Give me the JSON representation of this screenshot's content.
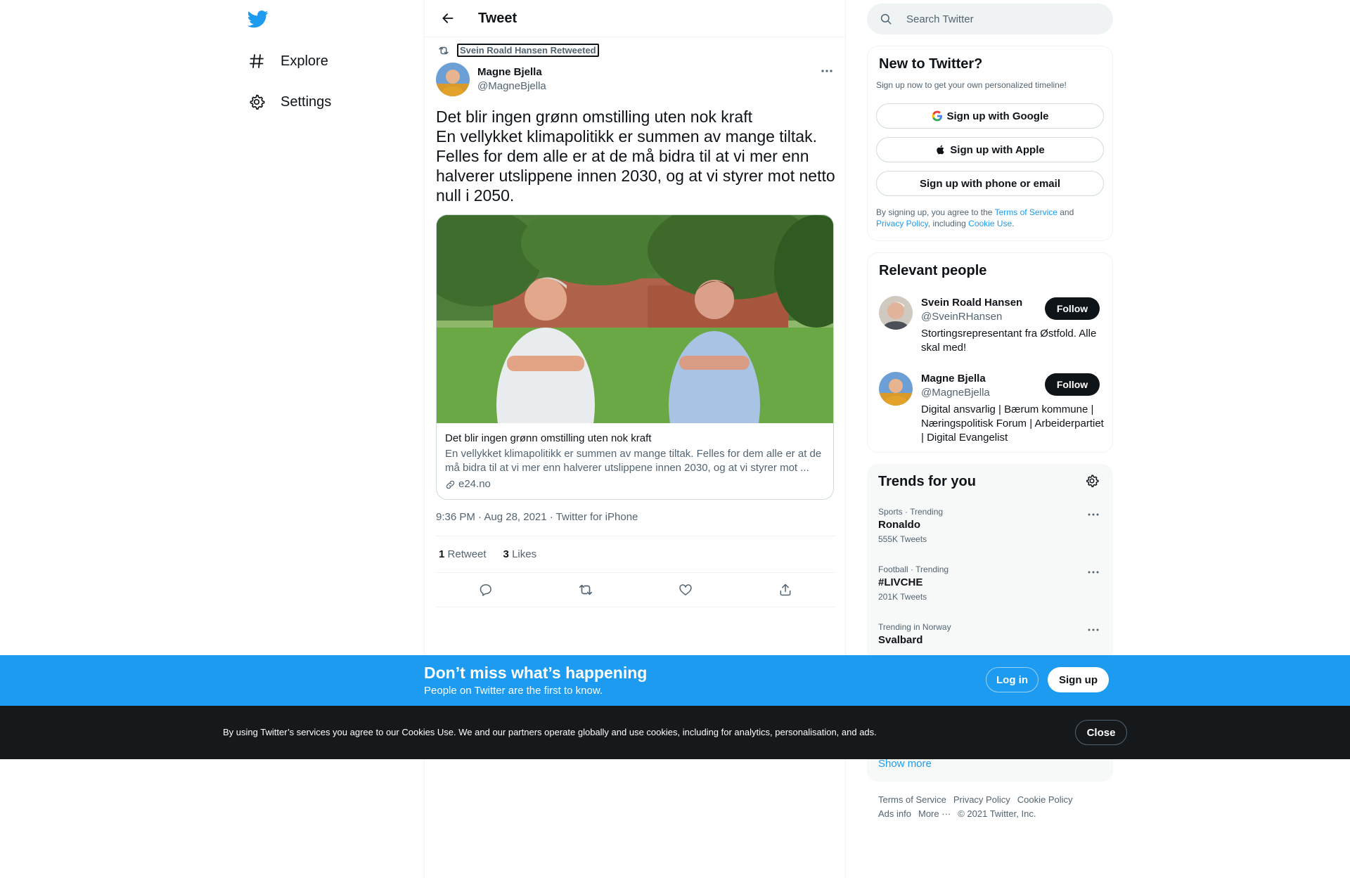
{
  "nav": {
    "logo": "twitter-bird-icon",
    "items": [
      {
        "label": "Explore",
        "icon": "hashtag-icon"
      },
      {
        "label": "Settings",
        "icon": "gear-icon"
      }
    ]
  },
  "header": {
    "title": "Tweet",
    "back_icon": "arrow-left-icon"
  },
  "tweet": {
    "retweeted_by": "Svein Roald Hansen Retweeted",
    "author_name": "Magne Bjella",
    "author_handle": "@MagneBjella",
    "text": "Det blir ingen grønn omstilling uten nok kraft\nEn vellykket klimapolitikk er summen av mange tiltak. Felles for dem alle er at de må bidra til at vi mer enn halverer utslippene innen 2030, og at vi styrer mot netto null i 2050.",
    "card": {
      "title": "Det blir ingen grønn omstilling uten nok kraft",
      "description": "En vellykket klimapolitikk er summen av mange tiltak. Felles for dem alle er at de må bidra til at vi mer enn halverer utslippene innen 2030, og at vi styrer mot ...",
      "domain": "e24.no"
    },
    "timestamp": "9:36 PM · Aug 28, 2021 · Twitter for iPhone",
    "retweets_count": "1",
    "retweets_label": "Retweet",
    "likes_count": "3",
    "likes_label": "Likes"
  },
  "search": {
    "placeholder": "Search Twitter"
  },
  "signup_panel": {
    "title": "New to Twitter?",
    "subtitle": "Sign up now to get your own personalized timeline!",
    "google": "Sign up with Google",
    "apple": "Sign up with Apple",
    "phone": "Sign up with phone or email",
    "legal_1": "By signing up, you agree to the ",
    "terms": "Terms of Service",
    "legal_2": " and ",
    "privacy": "Privacy Policy",
    "legal_3": ", including ",
    "cookie": "Cookie Use",
    "legal_4": "."
  },
  "relevant_people": {
    "title": "Relevant people",
    "people": [
      {
        "name": "Svein Roald Hansen",
        "handle": "@SveinRHansen",
        "bio": "Stortingsrepresentant fra Østfold. Alle skal med!",
        "follow": "Follow"
      },
      {
        "name": "Magne Bjella",
        "handle": "@MagneBjella",
        "bio": "Digital ansvarlig | Bærum kommune | Næringspolitisk Forum | Arbeiderpartiet | Digital Evangelist",
        "follow": "Follow"
      }
    ]
  },
  "trends": {
    "title": "Trends for you",
    "items": [
      {
        "category": "Sports · Trending",
        "name": "Ronaldo",
        "count": "555K Tweets"
      },
      {
        "category": "Football · Trending",
        "name": "#LIVCHE",
        "count": "201K Tweets"
      },
      {
        "category": "Trending in Norway",
        "name": "Svalbard",
        "count": ""
      }
    ],
    "show_more": "Show more"
  },
  "footer": {
    "terms": "Terms of Service",
    "privacy": "Privacy Policy",
    "cookie": "Cookie Policy",
    "ads": "Ads info",
    "more": "More ···",
    "copyright": "© 2021 Twitter, Inc."
  },
  "bottom_bar": {
    "title": "Don’t miss what’s happening",
    "subtitle": "People on Twitter are the first to know.",
    "login": "Log in",
    "signup": "Sign up"
  },
  "cookie_bar": {
    "text": "By using Twitter’s services you agree to our Cookies Use. We and our partners operate globally and use cookies, including for analytics, personalisation, and ads.",
    "close": "Close"
  },
  "colors": {
    "accent": "#1d9bf0",
    "text": "#0f1419",
    "muted": "#536471",
    "dark_bar": "#16191c"
  }
}
